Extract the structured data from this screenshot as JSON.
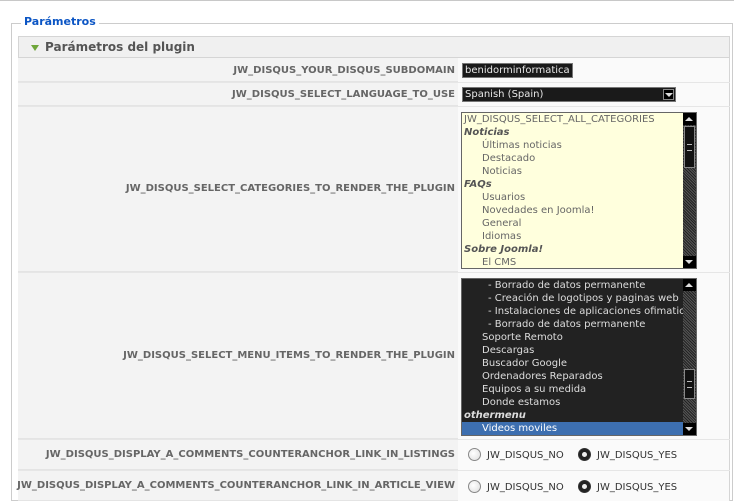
{
  "fieldset": {
    "legend": "Parámetros"
  },
  "panel": {
    "title": "Parámetros del plugin"
  },
  "params": {
    "subdomain": {
      "label": "JW_DISQUS_YOUR_DISQUS_SUBDOMAIN",
      "value": "benidorminformatica"
    },
    "language": {
      "label": "JW_DISQUS_SELECT_LANGUAGE_TO_USE",
      "selected": "Spanish (Spain)"
    },
    "categories": {
      "label": "JW_DISQUS_SELECT_CATEGORIES_TO_RENDER_THE_PLUGIN",
      "options": [
        {
          "text": "JW_DISQUS_SELECT_ALL_CATEGORIES",
          "kind": "option"
        },
        {
          "text": "Noticias",
          "kind": "group"
        },
        {
          "text": "Últimas noticias",
          "kind": "child"
        },
        {
          "text": "Destacado",
          "kind": "child"
        },
        {
          "text": "Noticias",
          "kind": "child"
        },
        {
          "text": "FAQs",
          "kind": "group"
        },
        {
          "text": "Usuarios",
          "kind": "child"
        },
        {
          "text": "Novedades en Joomla!",
          "kind": "child"
        },
        {
          "text": "General",
          "kind": "child"
        },
        {
          "text": "Idiomas",
          "kind": "child"
        },
        {
          "text": "Sobre Joomla!",
          "kind": "group"
        },
        {
          "text": "El CMS",
          "kind": "child"
        }
      ]
    },
    "menu_items": {
      "label": "JW_DISQUS_SELECT_MENU_ITEMS_TO_RENDER_THE_PLUGIN",
      "options": [
        {
          "text": "- Borrado de datos permanente",
          "kind": "sub"
        },
        {
          "text": "- Creación de logotipos y paginas web",
          "kind": "sub"
        },
        {
          "text": "- Instalaciones de aplicaciones ofimaticas,",
          "kind": "sub"
        },
        {
          "text": "- Borrado de datos permanente",
          "kind": "sub"
        },
        {
          "text": "Soporte Remoto",
          "kind": "child"
        },
        {
          "text": "Descargas",
          "kind": "child"
        },
        {
          "text": "Buscador Google",
          "kind": "child"
        },
        {
          "text": "Ordenadores Reparados",
          "kind": "child"
        },
        {
          "text": "Equipos a su medida",
          "kind": "child"
        },
        {
          "text": "Donde estamos",
          "kind": "child"
        },
        {
          "text": "othermenu",
          "kind": "group"
        },
        {
          "text": "Videos moviles",
          "kind": "child",
          "selected": true
        }
      ]
    },
    "counter_listings": {
      "label": "JW_DISQUS_DISPLAY_A_COMMENTS_COUNTERANCHOR_LINK_IN_LISTINGS",
      "no_label": "JW_DISQUS_NO",
      "yes_label": "JW_DISQUS_YES",
      "value": "yes"
    },
    "counter_article": {
      "label": "JW_DISQUS_DISPLAY_A_COMMENTS_COUNTERANCHOR_LINK_IN_ARTICLE_VIEW",
      "no_label": "JW_DISQUS_NO",
      "yes_label": "JW_DISQUS_YES",
      "value": "yes"
    }
  }
}
